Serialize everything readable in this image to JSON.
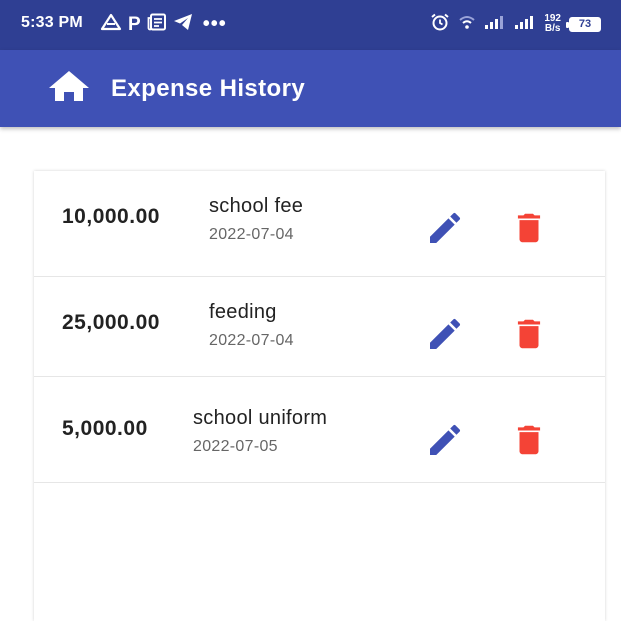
{
  "status_bar": {
    "time": "5:33 PM",
    "left_icons": [
      "google-drive-icon",
      "p-app-icon",
      "news-icon",
      "telegram-icon",
      "more-dots-icon"
    ],
    "dots": "•••",
    "p_letter": "P",
    "right_icons": [
      "alarm-icon",
      "wifi-icon",
      "signal-icon",
      "signal-icon",
      "network-speed",
      "battery-icon"
    ],
    "speed_value": "192",
    "speed_unit": "B/s",
    "battery": "73"
  },
  "app_bar": {
    "title": "Expense History",
    "icon": "home-icon",
    "color": "#3f51b5"
  },
  "expenses": [
    {
      "amount": "10,000.00",
      "description": "school fee",
      "date": "2022-07-04"
    },
    {
      "amount": "25,000.00",
      "description": "feeding",
      "date": "2022-07-04"
    },
    {
      "amount": "5,000.00",
      "description": "school uniform",
      "date": "2022-07-05"
    }
  ],
  "colors": {
    "status_bar": "#2f3f93",
    "edit_icon": "#3f51b5",
    "delete_icon": "#f44336"
  }
}
